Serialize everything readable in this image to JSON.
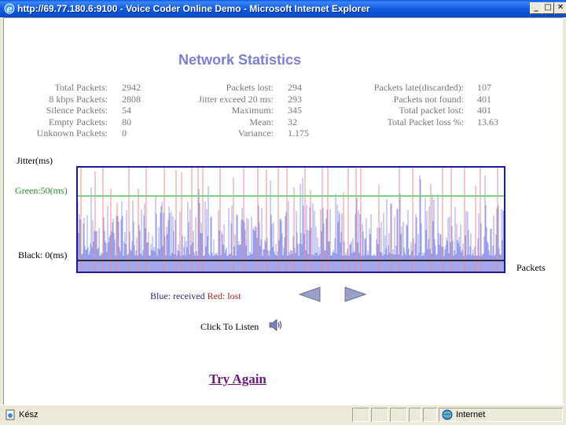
{
  "window": {
    "title": "http://69.77.180.6:9100 - Voice Coder Online Demo - Microsoft Internet Explorer",
    "minimize_label": "_",
    "maximize_label": "□",
    "close_label": "✕"
  },
  "page": {
    "heading": "Network Statistics",
    "stats": {
      "col1": [
        {
          "label": "Total Packets:",
          "value": "2942"
        },
        {
          "label": "8 kbps Packets:",
          "value": "2808"
        },
        {
          "label": "Silence Packets:",
          "value": "54"
        },
        {
          "label": "Empty Packets:",
          "value": "80"
        },
        {
          "label": "Unknown Packets:",
          "value": "0"
        }
      ],
      "col2": [
        {
          "label": "Packets lost:",
          "value": "294"
        },
        {
          "label": "Jitter exceed 20 ms:",
          "value": "293"
        },
        {
          "label": "Maximum:",
          "value": "345"
        },
        {
          "label": "Mean:",
          "value": "32"
        },
        {
          "label": "Variance:",
          "value": "1.175"
        }
      ],
      "col3": [
        {
          "label": "Packets late(discarded):",
          "value": "107"
        },
        {
          "label": "Packets not found:",
          "value": "401"
        },
        {
          "label": "Total packet lost:",
          "value": "401"
        },
        {
          "label": "Total Packet loss %:",
          "value": "13.63"
        }
      ]
    },
    "chart_labels": {
      "y_axis": "Jitter(ms)",
      "green_line": "Green:50(ms)",
      "black_line": "Black: 0(ms)",
      "x_axis": "Packets"
    },
    "legend": {
      "blue": "Blue: received",
      "red": "Red: lost"
    },
    "listen_label": "Click To Listen",
    "try_again": "Try Again"
  },
  "chart_data": {
    "type": "bar",
    "xlabel": "Packets",
    "ylabel": "Jitter(ms)",
    "reference_lines": [
      {
        "label": "Green:50(ms)",
        "value": 50,
        "color": "#7fd27f"
      },
      {
        "label": "Black: 0(ms)",
        "value": 0,
        "color": "#000000"
      }
    ],
    "series": [
      {
        "name": "Blue: received",
        "color": "#9a9ee8"
      },
      {
        "name": "Red: lost",
        "color": "#f08a8a"
      }
    ],
    "packet_count": 2942
  },
  "colors": {
    "heading": "#7b7fcd",
    "stat_text": "#777777",
    "chart_border": "#1a1a9a",
    "received": "#9a9ee8",
    "lost": "#f08a8a",
    "green_line": "#7fd27f",
    "link": "#6b1a7a"
  },
  "statusbar": {
    "status": "Kész",
    "zone": "Internet"
  },
  "icons": {
    "browser": "ie-icon",
    "prev": "arrow-left-icon",
    "next": "arrow-right-icon",
    "speaker": "speaker-icon",
    "status_doc": "document-icon",
    "zone": "globe-icon"
  }
}
